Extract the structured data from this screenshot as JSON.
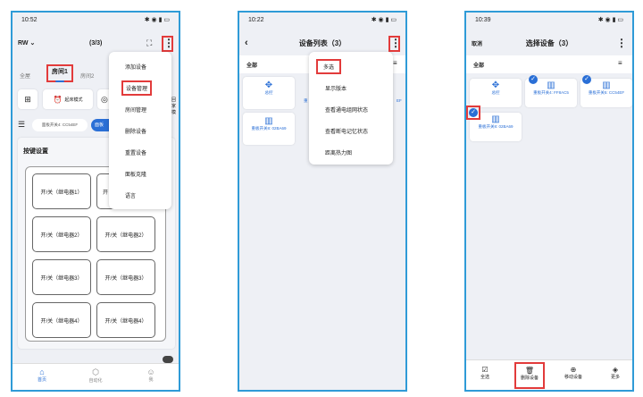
{
  "screen1": {
    "status_time": "10:52",
    "status_icons": "✱ ◉ ▮ ▭",
    "home_name": "RW",
    "page_count": "(3/3)",
    "tabs": [
      "全屋",
      "房间1",
      "房间2"
    ],
    "mode_btn1": "起床模式",
    "mode_btn3": "回家模",
    "device_chip": "面板开关4: CC54EF",
    "device_chip2": "面板",
    "section_title": "按键设置",
    "relay_buttons": [
      "开/关（继电器1）",
      "开/关（继电器2）",
      "开/关（继电器3）",
      "开/关（继电器4）",
      "开/关（继电器2）",
      "开/关（继电器3）",
      "开/关（继电器4）"
    ],
    "relay_cut": "开",
    "menu_items": [
      "添加设备",
      "设备管理",
      "房间管理",
      "删除设备",
      "重置设备",
      "面板克隆",
      "语言"
    ],
    "nav": [
      "首页",
      "自动化",
      "我"
    ]
  },
  "screen2": {
    "status_time": "10:22",
    "status_icons": "✱ ◉ ▮ ▭",
    "title": "设备列表（3）",
    "tab_all": "全部",
    "dev1": "总控",
    "dev2": "重",
    "dev3_right": "EF",
    "dev_bottom": "重板开关8: 02BA69",
    "menu_items": [
      "多选",
      "显示版本",
      "查看通电组网状态",
      "查看断电记忆状态",
      "距离热力图"
    ]
  },
  "screen3": {
    "status_time": "10:39",
    "status_icons": "✱ ◉ ▮ ▭",
    "cancel": "取消",
    "title": "选择设备（3）",
    "tab_all": "全部",
    "devices": [
      "总控",
      "重板开关4: FF8AC5",
      "重板开关5: CC54EF",
      "重板开关8: 02BA69"
    ],
    "bottom": [
      "全选",
      "删除设备",
      "移动设备",
      "更多"
    ]
  }
}
